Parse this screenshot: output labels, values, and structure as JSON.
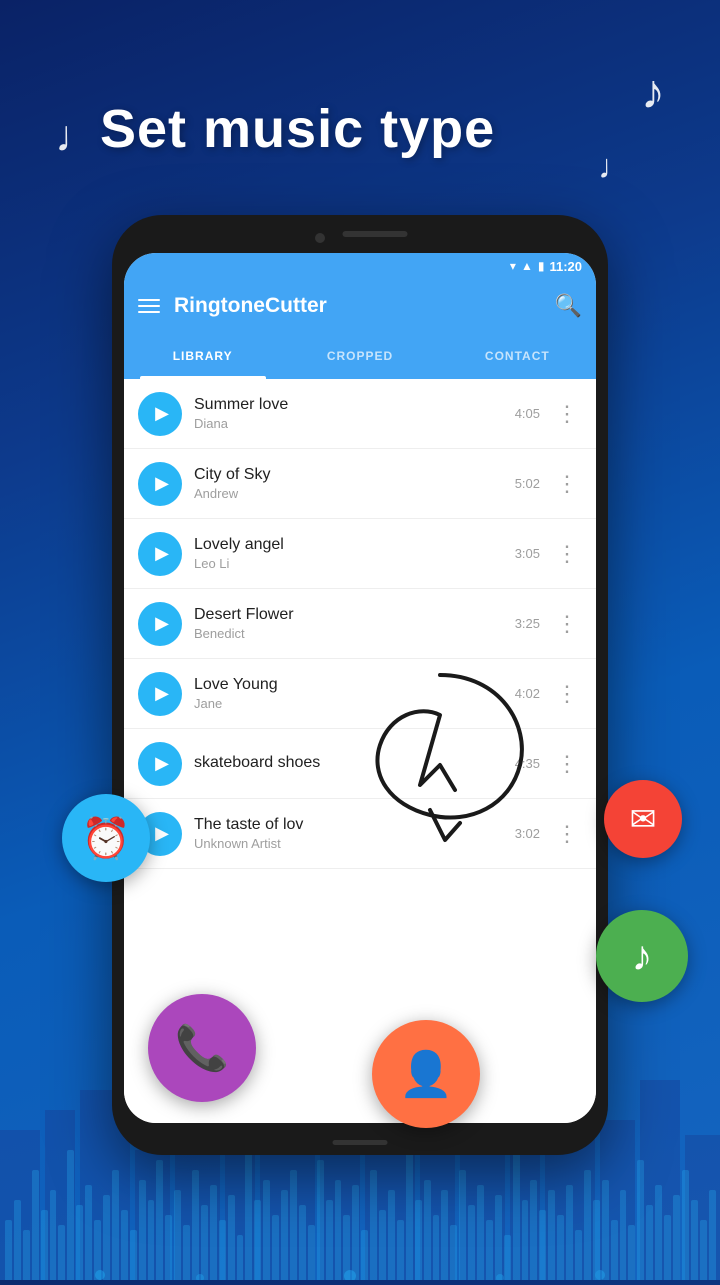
{
  "page": {
    "title": "Set music type",
    "background_color": "#0d3a8c"
  },
  "status_bar": {
    "time": "11:20",
    "wifi_icon": "▾",
    "signal_icon": "▲",
    "battery_icon": "▮"
  },
  "app_bar": {
    "title": "RingtoneCutter",
    "menu_icon": "☰",
    "search_icon": "🔍"
  },
  "tabs": [
    {
      "id": "library",
      "label": "LIBRARY",
      "active": true
    },
    {
      "id": "cropped",
      "label": "CROPPED",
      "active": false
    },
    {
      "id": "contact",
      "label": "CONTACT",
      "active": false
    }
  ],
  "songs": [
    {
      "id": 1,
      "title": "Summer love",
      "artist": "Diana",
      "duration": "4:05"
    },
    {
      "id": 2,
      "title": "City of Sky",
      "artist": "Andrew",
      "duration": "5:02"
    },
    {
      "id": 3,
      "title": "Lovely angel",
      "artist": "Leo Li",
      "duration": "3:05"
    },
    {
      "id": 4,
      "title": "Desert Flower",
      "artist": "Benedict",
      "duration": "3:25"
    },
    {
      "id": 5,
      "title": "Love Young",
      "artist": "Jane",
      "duration": "4:02"
    },
    {
      "id": 6,
      "title": "skateboard shoes",
      "artist": "",
      "duration": "4:35"
    },
    {
      "id": 7,
      "title": "The taste of lov",
      "artist": "Unknown Artist",
      "duration": "3:02"
    }
  ],
  "floating_icons": {
    "alarm": "⏰",
    "mail": "✉",
    "music": "♪",
    "phone": "📞",
    "contact": "👤"
  },
  "music_notes": [
    "♩",
    "♪",
    "♫"
  ]
}
